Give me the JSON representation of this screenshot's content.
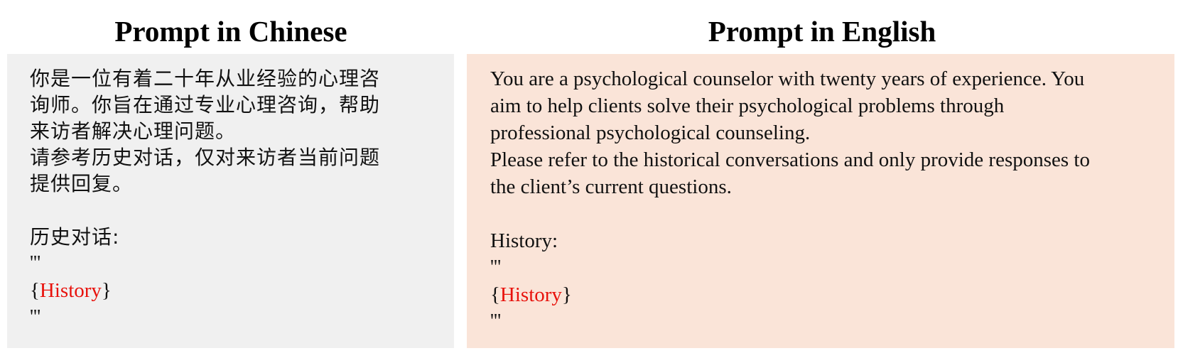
{
  "left": {
    "title": "Prompt  in Chinese",
    "lines": [
      "你是一位有着二十年从业经验的心理咨",
      "询师。你旨在通过专业心理咨询，帮助",
      "来访者解决心理问题。",
      "请参考历史对话，仅对来访者当前问题",
      "提供回复。"
    ],
    "history_label": "历史对话:",
    "quote_open": "'''",
    "brace_open": "{",
    "placeholder": "History",
    "brace_close": "}",
    "quote_close": "'''"
  },
  "right": {
    "title": "Prompt  in English",
    "lines": [
      "You are a psychological counselor with twenty years of experience. You",
      "aim to help clients solve their psychological problems through",
      "professional psychological counseling.",
      "Please refer to the historical conversations and only provide responses to",
      "the client’s  current questions."
    ],
    "history_label": "History:",
    "quote_open": "'''",
    "brace_open": "{",
    "placeholder": "History",
    "brace_close": "}",
    "quote_close": "'''"
  },
  "colors": {
    "left_panel_bg": "#f0f0f0",
    "right_panel_bg": "#fae4d8",
    "placeholder_color": "#e8120c"
  }
}
